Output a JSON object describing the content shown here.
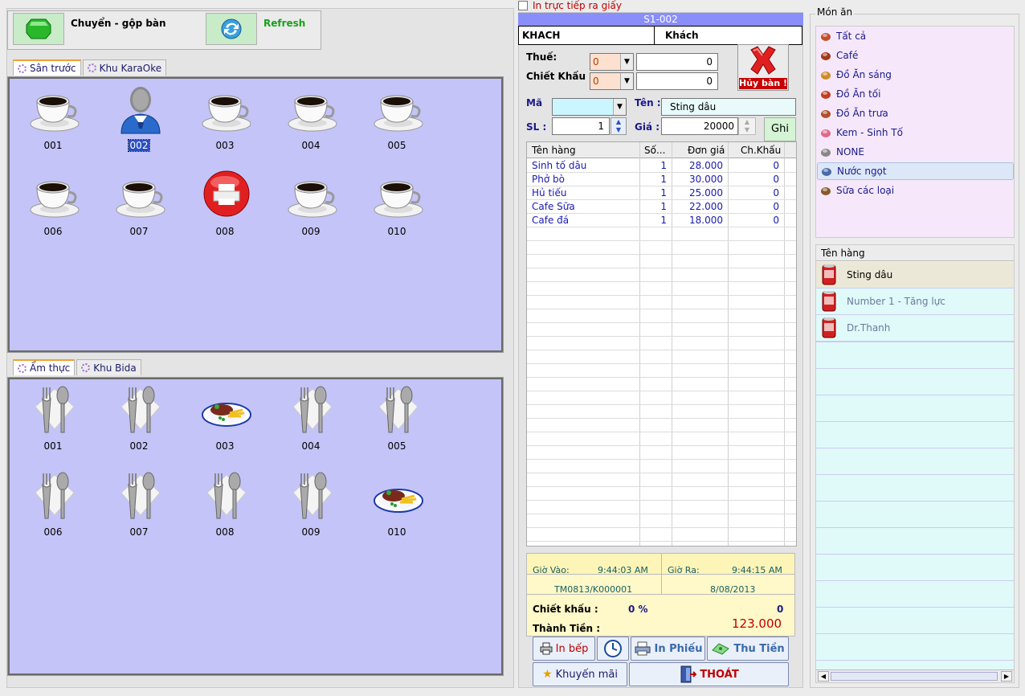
{
  "toolbar": {
    "move_label": "Chuyển - gộp bàn",
    "refresh_label": "Refresh"
  },
  "zone1": {
    "tabs": [
      "Sân trước",
      "Khu KaraOke"
    ],
    "tables": [
      {
        "id": "001",
        "icon": "coffee-cup"
      },
      {
        "id": "002",
        "icon": "customer",
        "selected": true
      },
      {
        "id": "003",
        "icon": "coffee-cup"
      },
      {
        "id": "004",
        "icon": "coffee-cup"
      },
      {
        "id": "005",
        "icon": "coffee-cup"
      },
      {
        "id": "006",
        "icon": "coffee-cup"
      },
      {
        "id": "007",
        "icon": "coffee-cup"
      },
      {
        "id": "008",
        "icon": "printer-red"
      },
      {
        "id": "009",
        "icon": "coffee-cup"
      },
      {
        "id": "010",
        "icon": "coffee-cup"
      }
    ]
  },
  "zone2": {
    "tabs": [
      "Ẩm thực",
      "Khu Bida"
    ],
    "tables": [
      {
        "id": "001",
        "icon": "cutlery"
      },
      {
        "id": "002",
        "icon": "cutlery"
      },
      {
        "id": "003",
        "icon": "food-plate"
      },
      {
        "id": "004",
        "icon": "cutlery"
      },
      {
        "id": "005",
        "icon": "cutlery"
      },
      {
        "id": "006",
        "icon": "cutlery"
      },
      {
        "id": "007",
        "icon": "cutlery"
      },
      {
        "id": "008",
        "icon": "cutlery"
      },
      {
        "id": "009",
        "icon": "cutlery"
      },
      {
        "id": "010",
        "icon": "food-plate"
      }
    ]
  },
  "order": {
    "print_direct_label": "In trực tiếp ra giấy",
    "table_title": "S1-002",
    "customer_code": "KHACH",
    "customer_name": "Khách",
    "tax_label": "Thuế:",
    "tax_combo": "0",
    "tax_value": "0",
    "discount_label": "Chiết Khấu :",
    "discount_combo": "0",
    "discount_value": "0",
    "cancel_label": "Hủy bàn !",
    "code_label": "Mã",
    "name_label": "Tên :",
    "name_value": "Sting dâu",
    "qty_label": "SL :",
    "qty_value": "1",
    "price_label": "Giá :",
    "price_value": "20000",
    "save_label": "Ghi",
    "columns": [
      "Tên hàng",
      "Số...",
      "Đơn giá",
      "Ch.Khấu"
    ],
    "rows": [
      {
        "name": "Sinh tố dâu",
        "qty": "1",
        "price": "28.000",
        "disc": "0"
      },
      {
        "name": "Phở bò",
        "qty": "1",
        "price": "30.000",
        "disc": "0"
      },
      {
        "name": "Hủ tiếu",
        "qty": "1",
        "price": "25.000",
        "disc": "0"
      },
      {
        "name": "Cafe Sữa",
        "qty": "1",
        "price": "22.000",
        "disc": "0"
      },
      {
        "name": "Cafe đá",
        "qty": "1",
        "price": "18.000",
        "disc": "0"
      }
    ],
    "time_in_label": "Giờ Vào:",
    "time_in": "9:44:03 AM",
    "time_out_label": "Giờ Ra:",
    "time_out": "9:44:15 AM",
    "invoice_code": "TM0813/K000001",
    "date": "8/08/2013",
    "discount_sum_label": "Chiết khấu :",
    "discount_pct": "0 %",
    "discount_amount": "0",
    "total_label": "Thành Tiền :",
    "total": "123.000",
    "buttons": {
      "kitchen": "In bếp",
      "print": "In Phiếu",
      "pay": "Thu Tiền",
      "promo": "Khuyến mãi",
      "exit": "THOÁT"
    }
  },
  "menu": {
    "title": "Món ăn",
    "categories": [
      "Tất cả",
      "Café",
      "Đồ Ăn sáng",
      "Đồ Ăn tối",
      "Đồ Ăn trưa",
      "Kem - Sinh Tố",
      "NONE",
      "Nước ngọt",
      "Sữa các loại"
    ],
    "selected_category": "Nước ngọt",
    "products_header": "Tên hàng",
    "products": [
      "Sting dâu",
      "Number 1 - Tăng lực",
      "Dr.Thanh"
    ]
  },
  "colors": {
    "table_area": "#c4c4f8",
    "title_bar": "#8a8ef8",
    "total": "#c00000"
  }
}
